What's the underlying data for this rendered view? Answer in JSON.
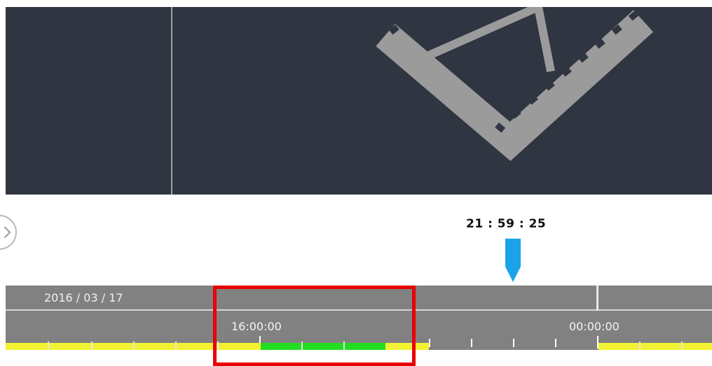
{
  "playback": {
    "current_time": "21 : 59 : 25"
  },
  "timeline": {
    "date": "2016 / 03 / 17",
    "tick_labels": [
      "16:00:00",
      "00:00:00"
    ]
  },
  "colors": {
    "video_bg": "#2f3541",
    "film_icon": "#9b9b9b",
    "timeline_bg": "#818181",
    "recording_continuous": "#f2f232",
    "recording_event": "#22dd22",
    "playhead": "#1aa3e8",
    "highlight": "#e80000"
  },
  "icons": {
    "video_placeholder": "film-strip-icon",
    "playhead": "playhead-marker-icon",
    "nav": "chevron-right-icon"
  }
}
